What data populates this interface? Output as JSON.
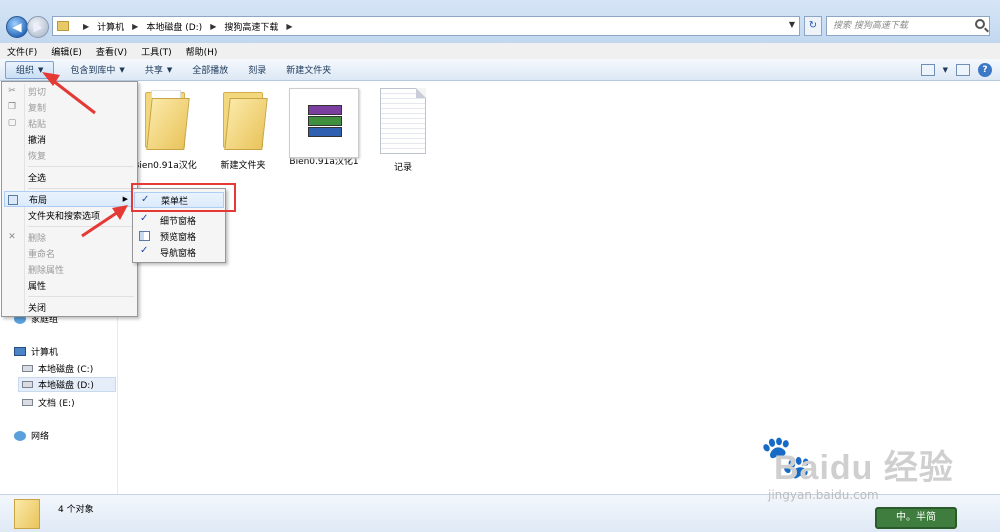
{
  "address": {
    "crumbs": [
      "计算机",
      "本地磁盘 (D:)",
      "搜狗高速下载"
    ],
    "search_placeholder": "搜索 搜狗高速下载"
  },
  "menubar": [
    "文件(F)",
    "编辑(E)",
    "查看(V)",
    "工具(T)",
    "帮助(H)"
  ],
  "toolbar": {
    "organize": "组织",
    "include_library": "包含到库中",
    "share": "共享",
    "play_all": "全部播放",
    "burn": "刻录",
    "new_folder": "新建文件夹"
  },
  "organize_menu": {
    "cut": "剪切",
    "copy": "复制",
    "paste": "粘贴",
    "undo": "撤消",
    "redo": "恢复",
    "select_all": "全选",
    "layout": "布局",
    "folder_options": "文件夹和搜索选项",
    "delete": "删除",
    "rename": "重命名",
    "remove_props": "删除属性",
    "properties": "属性",
    "close": "关闭"
  },
  "layout_submenu": {
    "menu_bar": "菜单栏",
    "details_pane": "细节窗格",
    "preview_pane": "预览窗格",
    "nav_pane": "导航窗格"
  },
  "nav": {
    "homegroup_partial": "家庭组",
    "computer": "计算机",
    "drive_c": "本地磁盘 (C:)",
    "drive_d": "本地磁盘 (D:)",
    "drive_e": "文档 (E:)",
    "network": "网络"
  },
  "files": [
    {
      "name": "Bien0.91a汉化",
      "type": "folder"
    },
    {
      "name": "新建文件夹",
      "type": "folder"
    },
    {
      "name": "Bien0.91a汉化1",
      "type": "rar"
    },
    {
      "name": "记录",
      "type": "text"
    }
  ],
  "status": {
    "count": "4 个对象"
  },
  "watermark": {
    "brand": "Baidu 经验",
    "url": "jingyan.baidu.com"
  },
  "badge": "中。半简"
}
